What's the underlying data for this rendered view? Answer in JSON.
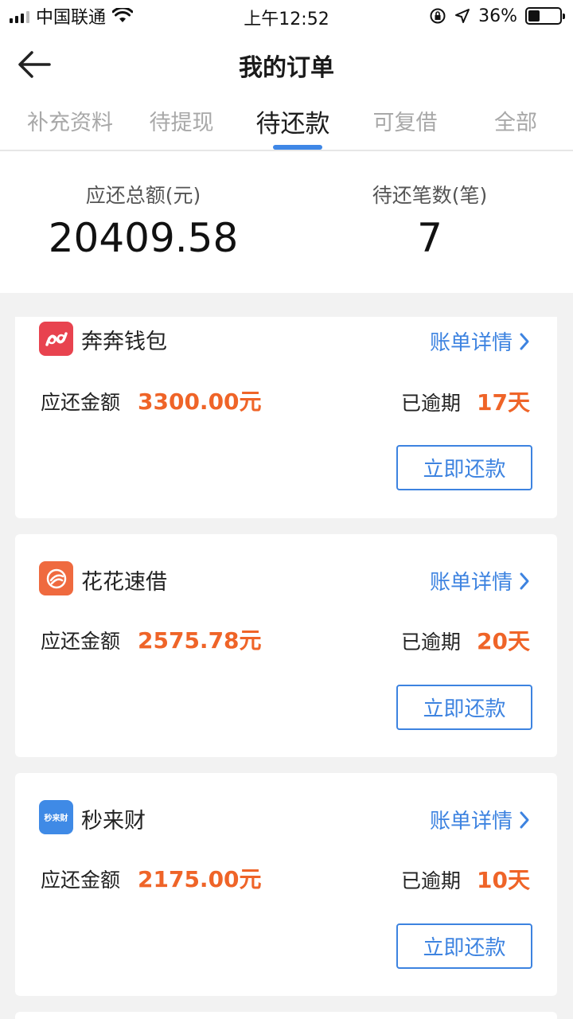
{
  "status_bar": {
    "carrier": "中国联通",
    "time": "上午12:52",
    "battery_pct": "36%",
    "battery_level": 0.36
  },
  "navbar": {
    "title": "我的订单",
    "back_icon": "arrow-left-icon"
  },
  "tabs": [
    {
      "label": "补充资料",
      "active": false
    },
    {
      "label": "待提现",
      "active": false
    },
    {
      "label": "待还款",
      "active": true
    },
    {
      "label": "可复借",
      "active": false
    },
    {
      "label": "全部",
      "active": false
    }
  ],
  "summary": {
    "total_label": "应还总额(元)",
    "total_value": "20409.58",
    "count_label": "待还笔数(笔)",
    "count_value": "7"
  },
  "orders": [
    {
      "app": "奔奔钱包",
      "logo_icon": "benben-wallet-logo-icon",
      "logo_color": "#e8434f",
      "detail_label": "账单详情",
      "amount_label": "应还金额",
      "amount": "3300.00元",
      "overdue_label": "已逾期",
      "overdue_days": "17天",
      "pay_label": "立即还款"
    },
    {
      "app": "花花速借",
      "logo_icon": "huahua-loan-logo-icon",
      "logo_color": "#ef6a3f",
      "detail_label": "账单详情",
      "amount_label": "应还金额",
      "amount": "2575.78元",
      "overdue_label": "已逾期",
      "overdue_days": "20天",
      "pay_label": "立即还款"
    },
    {
      "app": "秒来财",
      "logo_icon": "miaolaicai-logo-icon",
      "logo_text": "秒来财",
      "logo_color": "#3f8ae6",
      "detail_label": "账单详情",
      "amount_label": "应还金额",
      "amount": "2175.00元",
      "overdue_label": "已逾期",
      "overdue_days": "10天",
      "pay_label": "立即还款"
    }
  ],
  "colors": {
    "accent_blue": "#3d83e0",
    "amount_orange": "#ef6428",
    "tab_indicator": "#3f87e6",
    "page_bg": "#f2f2f2"
  }
}
